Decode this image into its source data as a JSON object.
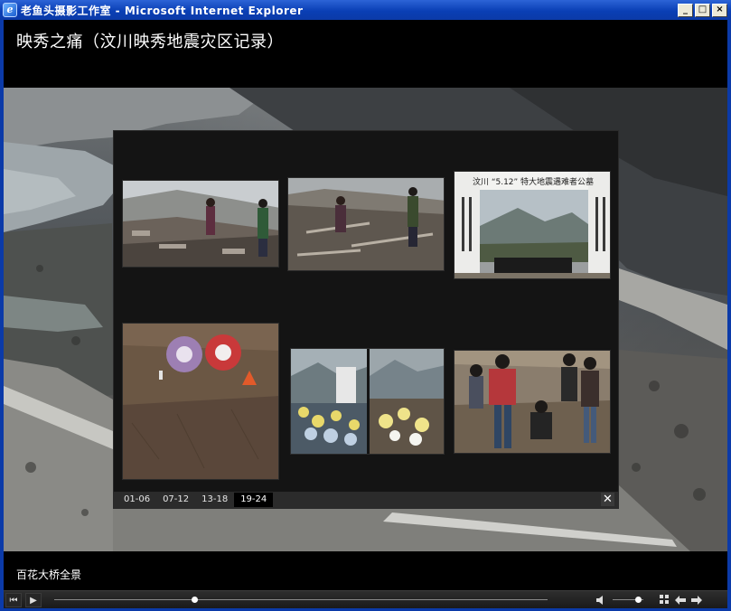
{
  "window": {
    "title": "老鱼头摄影工作室 - Microsoft Internet Explorer",
    "icon": "ie-icon",
    "buttons": {
      "minimize": "_",
      "maximize": "□",
      "close": "×"
    }
  },
  "gallery": {
    "title": "映秀之痛（汶川映秀地震灾区记录）",
    "caption": "百花大桥全景"
  },
  "thumbnails": {
    "memorial_text": {
      "top": "汶川 “5.12” 特大地震遇难者公墓"
    }
  },
  "pagination": {
    "tabs": [
      {
        "label": "01-06",
        "active": false
      },
      {
        "label": "07-12",
        "active": false
      },
      {
        "label": "13-18",
        "active": false
      },
      {
        "label": "19-24",
        "active": true
      }
    ],
    "close_glyph": "✕"
  },
  "controls": {
    "first_glyph": "⏮",
    "play_glyph": "▶",
    "progress": 0.285,
    "volume": 0.85,
    "volume_icon": "speaker-icon",
    "grid_icon": "grid-icon",
    "prev_icon": "arrow-left-icon",
    "next_icon": "arrow-right-icon"
  }
}
